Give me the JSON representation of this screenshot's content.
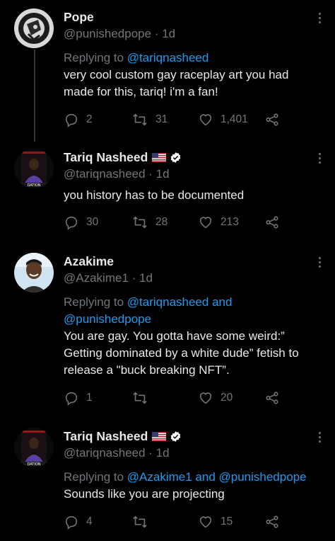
{
  "colors": {
    "background": "#000000",
    "text": "#e7e9ea",
    "secondary": "#71767b",
    "link": "#1d9bf0",
    "verified": "#ffffff"
  },
  "tweets": [
    {
      "name": "Pope",
      "handle": "@punishedpope",
      "time": " · 1d",
      "replying_prefix": "Replying to ",
      "mentions": [
        "@tariqnasheed"
      ],
      "mention_joiner": "",
      "text": "very cool custom gay raceplay art you had made for this, tariq! i'm a fan!",
      "has_flag": false,
      "verified": false,
      "avatar": "pope-avatar",
      "stats": {
        "replies": "2",
        "retweets": "31",
        "likes": "1,401"
      }
    },
    {
      "name": "Tariq Nasheed",
      "handle": "@tariqnasheed",
      "time": " · 1d",
      "replying_prefix": "",
      "mentions": [],
      "mention_joiner": "",
      "text": "you history has to be documented",
      "has_flag": true,
      "verified": true,
      "avatar": "tariq-avatar",
      "stats": {
        "replies": "30",
        "retweets": "28",
        "likes": "213"
      }
    },
    {
      "name": "Azakime",
      "handle": "@Azakime1",
      "time": " · 1d",
      "replying_prefix": "Replying to ",
      "mentions": [
        "@tariqnasheed",
        "@punishedpope"
      ],
      "mention_joiner": " and ",
      "text": "You are gay. You gotta have some weird:” Getting dominated by a white dude” fetish to release a \"buck breaking NFT”.",
      "has_flag": false,
      "verified": false,
      "avatar": "azakime-avatar",
      "stats": {
        "replies": "1",
        "retweets": "",
        "likes": "20"
      }
    },
    {
      "name": "Tariq Nasheed",
      "handle": "@tariqnasheed",
      "time": " · 1d",
      "replying_prefix": "Replying to ",
      "mentions": [
        "@Azakime1",
        "@punishedpope"
      ],
      "mention_joiner": " and ",
      "text": "Sounds like you are projecting",
      "has_flag": true,
      "verified": true,
      "avatar": "tariq-avatar",
      "stats": {
        "replies": "4",
        "retweets": "",
        "likes": "15"
      }
    }
  ]
}
